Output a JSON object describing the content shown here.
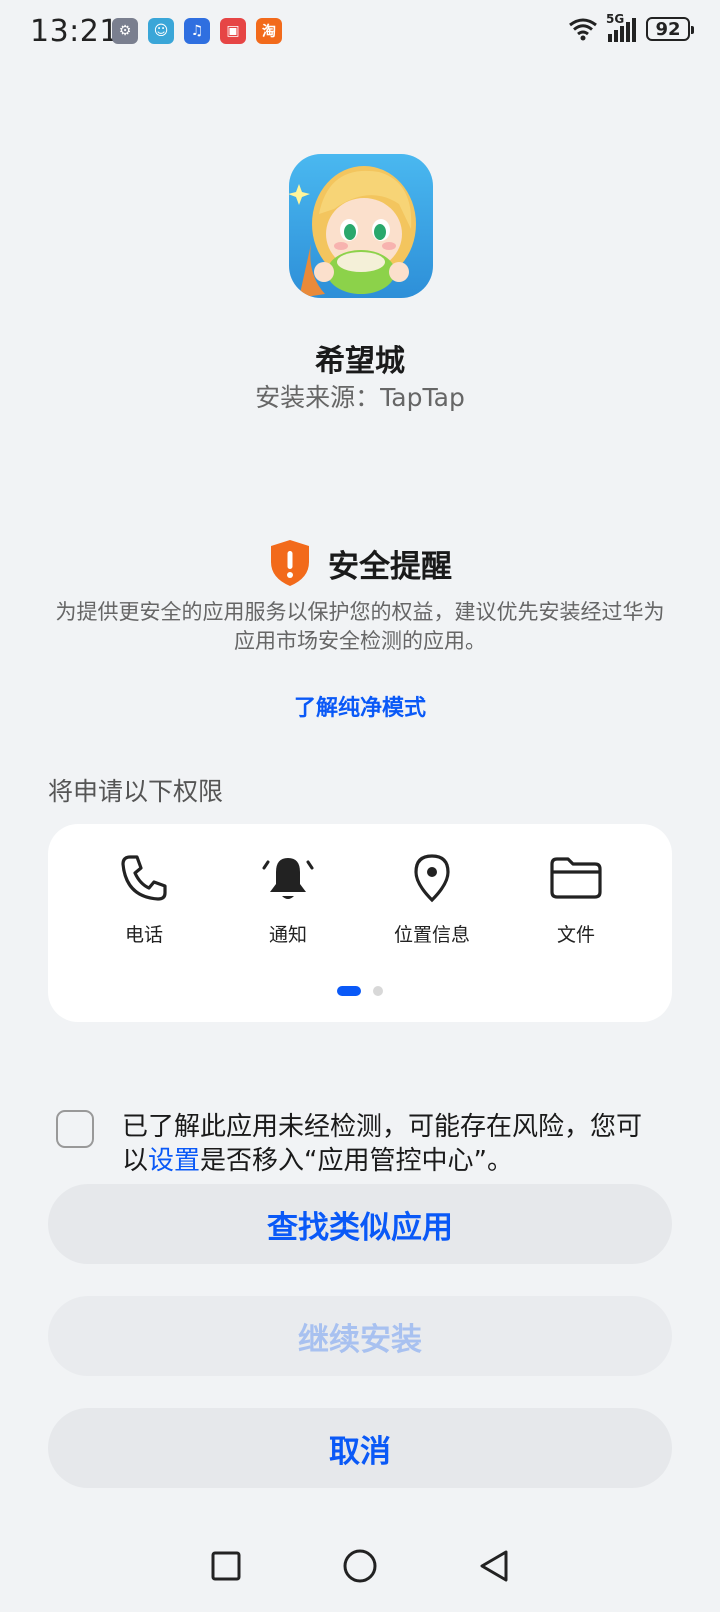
{
  "status_bar": {
    "time": "13:21",
    "apps": [
      {
        "name": "settings-app-icon",
        "glyph": "⚙",
        "color": "#7a7f8f"
      },
      {
        "name": "avatar-app-icon",
        "glyph": "☺",
        "color": "#3aa6d8"
      },
      {
        "name": "music-app-icon",
        "glyph": "♫",
        "color": "#2f6fe0"
      },
      {
        "name": "book-app-icon",
        "glyph": "▣",
        "color": "#e64545"
      },
      {
        "name": "taobao-app-icon",
        "glyph": "淘",
        "color": "#f26a1b"
      }
    ],
    "network": "5G",
    "battery": "92"
  },
  "app": {
    "name": "希望城",
    "source": "安装来源：TapTap"
  },
  "security": {
    "title": "安全提醒",
    "description": "为提供更安全的应用服务以保护您的权益，建议优先安装经过华为应用市场安全检测的应用。",
    "learn_more": "了解纯净模式"
  },
  "permissions": {
    "label": "将申请以下权限",
    "items": [
      {
        "label": "电话",
        "icon": "phone-icon"
      },
      {
        "label": "通知",
        "icon": "bell-icon"
      },
      {
        "label": "位置信息",
        "icon": "location-icon"
      },
      {
        "label": "文件",
        "icon": "folder-icon"
      }
    ],
    "page": 1,
    "pages": 2
  },
  "consent": {
    "text_before": "已了解此应用未经检测，可能存在风险，您可以",
    "link": "设置",
    "text_after": "是否移入“应用管控中心”。"
  },
  "buttons": {
    "find_similar": "查找类似应用",
    "continue_install": "继续安装",
    "cancel": "取消"
  },
  "colors": {
    "accent": "#0a59f7",
    "warning": "#f26a1b",
    "background": "#f1f3f5"
  }
}
